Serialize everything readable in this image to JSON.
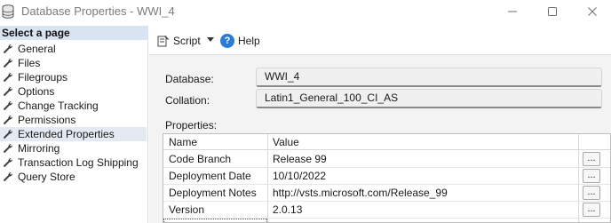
{
  "window": {
    "title": "Database Properties - WWI_4",
    "app_icon": "database-icon",
    "controls": {
      "minimize": "minimize-icon",
      "maximize": "maximize-icon",
      "close": "close-icon"
    }
  },
  "sidebar": {
    "header": "Select a page",
    "items": [
      {
        "label": "General",
        "icon": "wrench-icon",
        "selected": false
      },
      {
        "label": "Files",
        "icon": "wrench-icon",
        "selected": false
      },
      {
        "label": "Filegroups",
        "icon": "wrench-icon",
        "selected": false
      },
      {
        "label": "Options",
        "icon": "wrench-icon",
        "selected": false
      },
      {
        "label": "Change Tracking",
        "icon": "wrench-icon",
        "selected": false
      },
      {
        "label": "Permissions",
        "icon": "wrench-icon",
        "selected": false
      },
      {
        "label": "Extended Properties",
        "icon": "wrench-icon",
        "selected": true
      },
      {
        "label": "Mirroring",
        "icon": "wrench-icon",
        "selected": false
      },
      {
        "label": "Transaction Log Shipping",
        "icon": "wrench-icon",
        "selected": false
      },
      {
        "label": "Query Store",
        "icon": "wrench-icon",
        "selected": false
      }
    ]
  },
  "toolbar": {
    "script_label": "Script",
    "help_label": "Help"
  },
  "form": {
    "database_label": "Database:",
    "database_value": "WWI_4",
    "collation_label": "Collation:",
    "collation_value": "Latin1_General_100_CI_AS",
    "properties_label": "Properties:"
  },
  "properties_grid": {
    "columns": [
      "Name",
      "Value"
    ],
    "rows": [
      {
        "name": "Code Branch",
        "value": "Release 99",
        "button": "..."
      },
      {
        "name": "Deployment Date",
        "value": "10/10/2022",
        "button": "..."
      },
      {
        "name": "Deployment Notes",
        "value": "http://vsts.microsoft.com/Release_99",
        "button": "..."
      },
      {
        "name": "Version",
        "value": "2.0.13",
        "button": "..."
      }
    ]
  },
  "colors": {
    "sidebar_header_bg": "#d9e4f2",
    "selected_item_bg": "#e5eaf2",
    "content_bg": "#f3f3f3",
    "help_icon": "#2a7ad8"
  }
}
